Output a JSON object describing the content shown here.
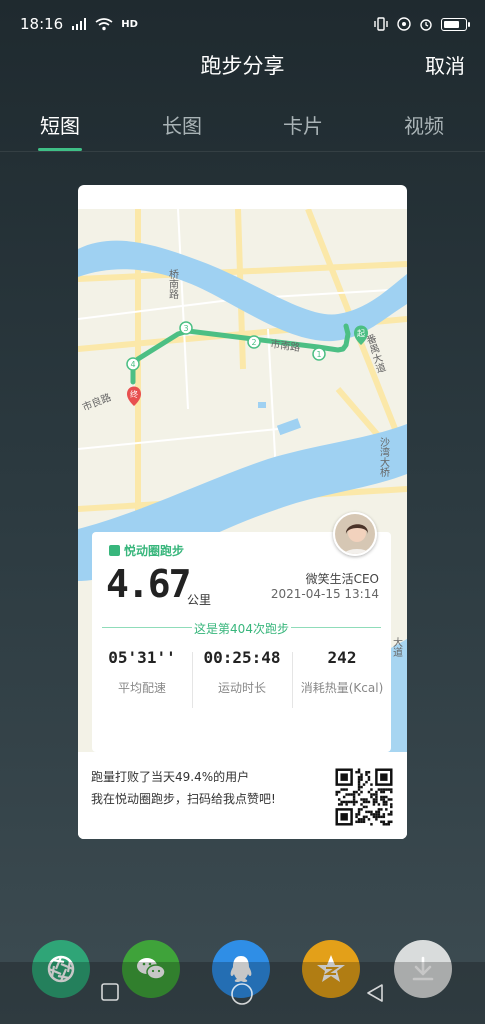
{
  "status": {
    "time": "18:16",
    "signal_icon": "signal-icon",
    "wifi_icon": "wifi-icon",
    "hd_label": "HD",
    "battery_level": 0.8
  },
  "header": {
    "title": "跑步分享",
    "cancel_label": "取消"
  },
  "tabs": [
    {
      "label": "短图",
      "active": true
    },
    {
      "label": "长图",
      "active": false
    },
    {
      "label": "卡片",
      "active": false
    },
    {
      "label": "视频",
      "active": false
    }
  ],
  "map": {
    "road_labels": [
      "桥南路",
      "市南路",
      "市良路",
      "沙湾大桥",
      "番禺大道",
      "大道"
    ],
    "start_label": "起",
    "end_label": "终",
    "checkpoints": [
      "1",
      "2",
      "3",
      "4"
    ],
    "colors": {
      "route": "#4cbf84",
      "water": "#9fd1f2",
      "land": "#f3f2e7",
      "road": "#fbe8a9"
    }
  },
  "card": {
    "brand": "悦动圈跑步",
    "distance": "4.67",
    "distance_unit": "公里",
    "username": "微笑生活CEO",
    "datetime": "2021-04-15 13:14",
    "run_count_text": "这是第404次跑步",
    "metrics": [
      {
        "value": "05'31''",
        "label": "平均配速"
      },
      {
        "value": "00:25:48",
        "label": "运动时长"
      },
      {
        "value": "242",
        "label": "消耗热量(Kcal)"
      }
    ],
    "footer_line1": "跑量打败了当天49.4%的用户",
    "footer_line2": "我在悦动圈跑步，扫码给我点赞吧!",
    "accent": "#38b67c"
  },
  "share": [
    {
      "name": "moments-share",
      "icon": "aperture-icon",
      "color": "#2fa577"
    },
    {
      "name": "wechat-share",
      "icon": "wechat-icon",
      "color": "#3fa33a"
    },
    {
      "name": "qq-share",
      "icon": "qq-icon",
      "color": "#2f8ee6"
    },
    {
      "name": "qzone-share",
      "icon": "star-icon",
      "color": "#e3a019"
    },
    {
      "name": "download-save",
      "icon": "download-icon",
      "color": "#d9dcdc"
    }
  ]
}
